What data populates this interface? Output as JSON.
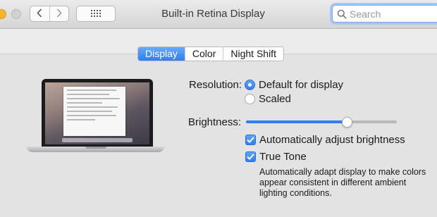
{
  "window": {
    "title": "Built-in Retina Display"
  },
  "search": {
    "placeholder": "Search"
  },
  "tabs": [
    {
      "label": "Display",
      "active": true
    },
    {
      "label": "Color",
      "active": false
    },
    {
      "label": "Night Shift",
      "active": false
    }
  ],
  "resolution": {
    "label": "Resolution:",
    "options": [
      {
        "label": "Default for display",
        "selected": true
      },
      {
        "label": "Scaled",
        "selected": false
      }
    ]
  },
  "brightness": {
    "label": "Brightness:",
    "level": 0.67,
    "auto_adjust": {
      "label": "Automatically adjust brightness",
      "checked": true
    }
  },
  "true_tone": {
    "label": "True Tone",
    "checked": true,
    "description": "Automatically adapt display to make colors appear consistent in different ambient lighting conditions."
  },
  "colors": {
    "accent": "#2f7ff0",
    "window_bg": "#e3e3e3"
  },
  "icons": [
    "back-chevron-icon",
    "forward-chevron-icon",
    "show-all-grid-icon",
    "search-icon",
    "checkmark-icon",
    "macbook-display-icon"
  ]
}
